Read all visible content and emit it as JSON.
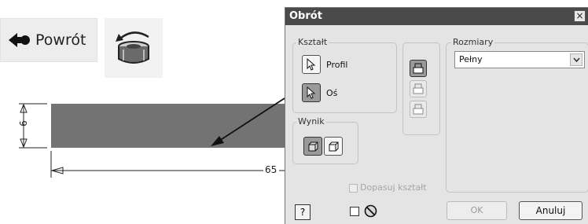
{
  "toolbar": {
    "back_label": "Powrót",
    "back_icon": "arrow-left-icon",
    "revolve_icon": "revolve-icon"
  },
  "drawing": {
    "height_dim": "6",
    "length_dim": "65"
  },
  "dialog": {
    "title": "Obrót",
    "close_glyph": "×",
    "ksztalt": {
      "label": "Kształt",
      "profil_label": "Profil",
      "os_label": "Oś"
    },
    "wynik": {
      "label": "Wynik"
    },
    "rozmiary": {
      "label": "Rozmiary",
      "selected": "Pełny"
    },
    "dopasuj_label": "Dopasuj kształt",
    "help_label": "?",
    "ok_label": "OK",
    "cancel_label": "Anuluj"
  }
}
